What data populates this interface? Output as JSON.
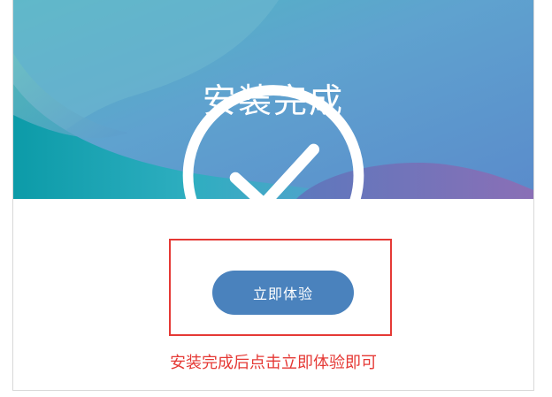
{
  "header": {
    "title": "安装完成",
    "icon": "check-circle-icon",
    "gradient_colors": [
      "#12a4ae",
      "#5ea6c7",
      "#5a8fc7",
      "#6b6fb5"
    ]
  },
  "action": {
    "label": "立即体验",
    "color": "#4a82bd"
  },
  "annotation": {
    "text": "安装完成后点击立即体验即可",
    "color": "#e53935"
  }
}
